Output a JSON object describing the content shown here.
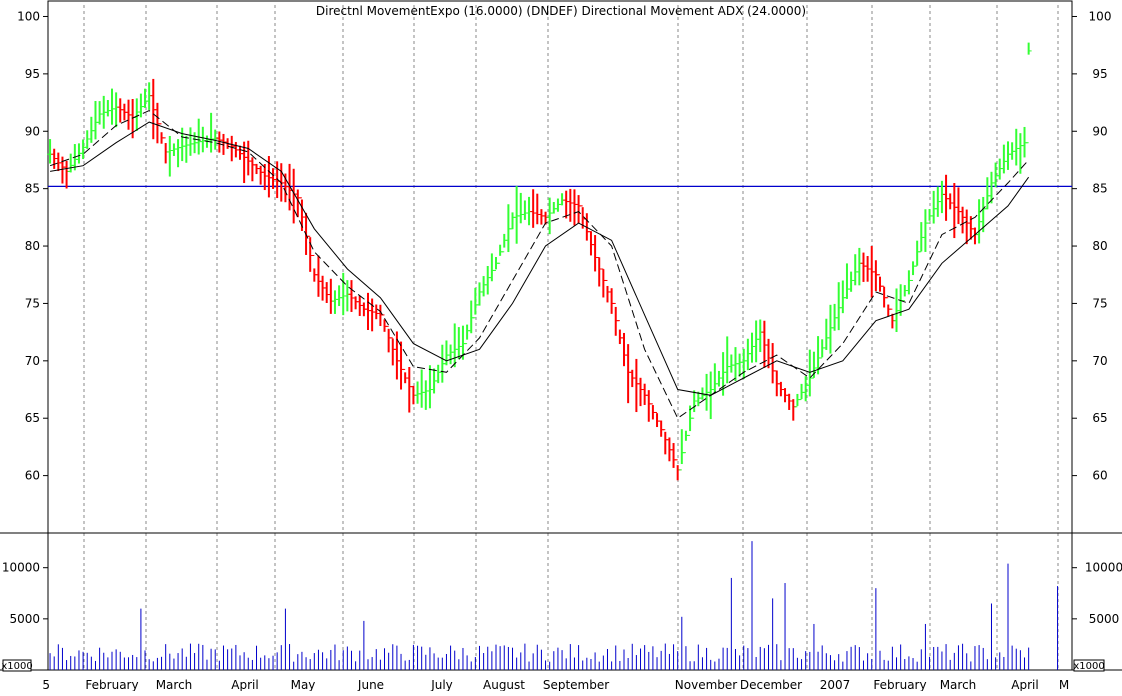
{
  "header": {
    "title": "Directnl MovementExpo (16.0000) (DNDEF) Directional Movement ADX (24.0000)"
  },
  "colors": {
    "up": "#33ff33",
    "down": "#ff0000",
    "grid": "#888888",
    "volume": "#0000cc",
    "reference_line": "#0000cc",
    "moving_average": "#000000",
    "background": "#ffffff"
  },
  "chart_data": [
    {
      "type": "ohlc",
      "title": "Directnl MovementExpo (16.0000) (DNDEF) Directional Movement ADX (24.0000)",
      "x_tick_labels": [
        "5",
        "February",
        "March",
        "April",
        "May",
        "June",
        "July",
        "August",
        "September",
        "November",
        "December",
        "2007",
        "February",
        "March",
        "April",
        "M"
      ],
      "y_range": [
        55,
        101
      ],
      "y_ticks": [
        60,
        65,
        70,
        75,
        80,
        85,
        90,
        95,
        100
      ],
      "reference_line": 85.2,
      "grid": true,
      "series_points": [
        [
          0,
          88.0
        ],
        [
          4,
          86.5
        ],
        [
          8,
          88.6
        ],
        [
          12,
          91.5
        ],
        [
          16,
          92.1
        ],
        [
          20,
          91.2
        ],
        [
          24,
          93.1
        ],
        [
          28,
          88.2
        ],
        [
          32,
          88.7
        ],
        [
          36,
          89.1
        ],
        [
          40,
          89.4
        ],
        [
          44,
          88.7
        ],
        [
          48,
          87.4
        ],
        [
          52,
          86.1
        ],
        [
          56,
          85.5
        ],
        [
          60,
          84.2
        ],
        [
          64,
          77.5
        ],
        [
          68,
          75.2
        ],
        [
          72,
          75.8
        ],
        [
          76,
          74.5
        ],
        [
          80,
          74.0
        ],
        [
          84,
          70.0
        ],
        [
          88,
          67.0
        ],
        [
          92,
          67.5
        ],
        [
          96,
          70.5
        ],
        [
          100,
          71.5
        ],
        [
          104,
          76.0
        ],
        [
          108,
          78.5
        ],
        [
          112,
          82.5
        ],
        [
          116,
          83.0
        ],
        [
          120,
          82.5
        ],
        [
          124,
          84.0
        ],
        [
          128,
          83.5
        ],
        [
          132,
          79.0
        ],
        [
          136,
          75.0
        ],
        [
          140,
          69.0
        ],
        [
          144,
          67.0
        ],
        [
          148,
          64.0
        ],
        [
          152,
          60.5
        ],
        [
          156,
          66.5
        ],
        [
          160,
          67.5
        ],
        [
          164,
          69.5
        ],
        [
          168,
          70.0
        ],
        [
          172,
          72.5
        ],
        [
          176,
          68.0
        ],
        [
          180,
          66.0
        ],
        [
          184,
          68.5
        ],
        [
          188,
          72.0
        ],
        [
          192,
          75.5
        ],
        [
          196,
          78.5
        ],
        [
          200,
          77.5
        ],
        [
          204,
          73.5
        ],
        [
          208,
          77.0
        ],
        [
          212,
          82.0
        ],
        [
          216,
          84.5
        ],
        [
          220,
          83.0
        ],
        [
          224,
          81.0
        ],
        [
          228,
          85.5
        ],
        [
          232,
          88.0
        ],
        [
          236,
          89.0
        ],
        [
          237,
          97.0
        ]
      ],
      "moving_average_fast": [
        [
          0,
          87.0
        ],
        [
          8,
          88.0
        ],
        [
          16,
          90.5
        ],
        [
          24,
          91.8
        ],
        [
          32,
          89.5
        ],
        [
          40,
          89.0
        ],
        [
          48,
          88.2
        ],
        [
          56,
          85.5
        ],
        [
          64,
          79.5
        ],
        [
          72,
          76.5
        ],
        [
          80,
          74.3
        ],
        [
          88,
          69.5
        ],
        [
          96,
          69.0
        ],
        [
          104,
          72.0
        ],
        [
          112,
          77.0
        ],
        [
          120,
          82.0
        ],
        [
          128,
          83.0
        ],
        [
          136,
          80.0
        ],
        [
          144,
          71.0
        ],
        [
          152,
          65.0
        ],
        [
          160,
          67.0
        ],
        [
          168,
          69.0
        ],
        [
          176,
          70.5
        ],
        [
          184,
          68.5
        ],
        [
          192,
          71.5
        ],
        [
          200,
          76.0
        ],
        [
          208,
          75.0
        ],
        [
          216,
          81.0
        ],
        [
          224,
          82.5
        ],
        [
          232,
          85.5
        ],
        [
          237,
          87.5
        ]
      ],
      "moving_average_slow": [
        [
          0,
          86.5
        ],
        [
          8,
          87.0
        ],
        [
          16,
          89.0
        ],
        [
          24,
          90.8
        ],
        [
          32,
          89.8
        ],
        [
          40,
          89.2
        ],
        [
          48,
          88.5
        ],
        [
          56,
          86.5
        ],
        [
          64,
          81.5
        ],
        [
          72,
          78.0
        ],
        [
          80,
          75.5
        ],
        [
          88,
          71.5
        ],
        [
          96,
          70.0
        ],
        [
          104,
          71.0
        ],
        [
          112,
          75.0
        ],
        [
          120,
          80.0
        ],
        [
          128,
          82.0
        ],
        [
          136,
          80.5
        ],
        [
          144,
          74.0
        ],
        [
          152,
          67.5
        ],
        [
          160,
          67.0
        ],
        [
          168,
          68.5
        ],
        [
          176,
          70.0
        ],
        [
          184,
          69.0
        ],
        [
          192,
          70.0
        ],
        [
          200,
          73.5
        ],
        [
          208,
          74.5
        ],
        [
          216,
          78.5
        ],
        [
          224,
          81.0
        ],
        [
          232,
          83.5
        ],
        [
          237,
          86.0
        ]
      ]
    },
    {
      "type": "bar",
      "title": "",
      "y_range": [
        0,
        13000
      ],
      "y_ticks": [
        5000,
        10000
      ],
      "unit_label": "x1000",
      "highlight_volumes": [
        [
          22,
          6000
        ],
        [
          57,
          6000
        ],
        [
          76,
          4800
        ],
        [
          153,
          5200
        ],
        [
          165,
          9000
        ],
        [
          170,
          12600
        ],
        [
          175,
          7000
        ],
        [
          178,
          8500
        ],
        [
          185,
          4500
        ],
        [
          200,
          8000
        ],
        [
          212,
          4500
        ],
        [
          228,
          6500
        ],
        [
          232,
          10400
        ],
        [
          244,
          8200
        ]
      ]
    }
  ]
}
